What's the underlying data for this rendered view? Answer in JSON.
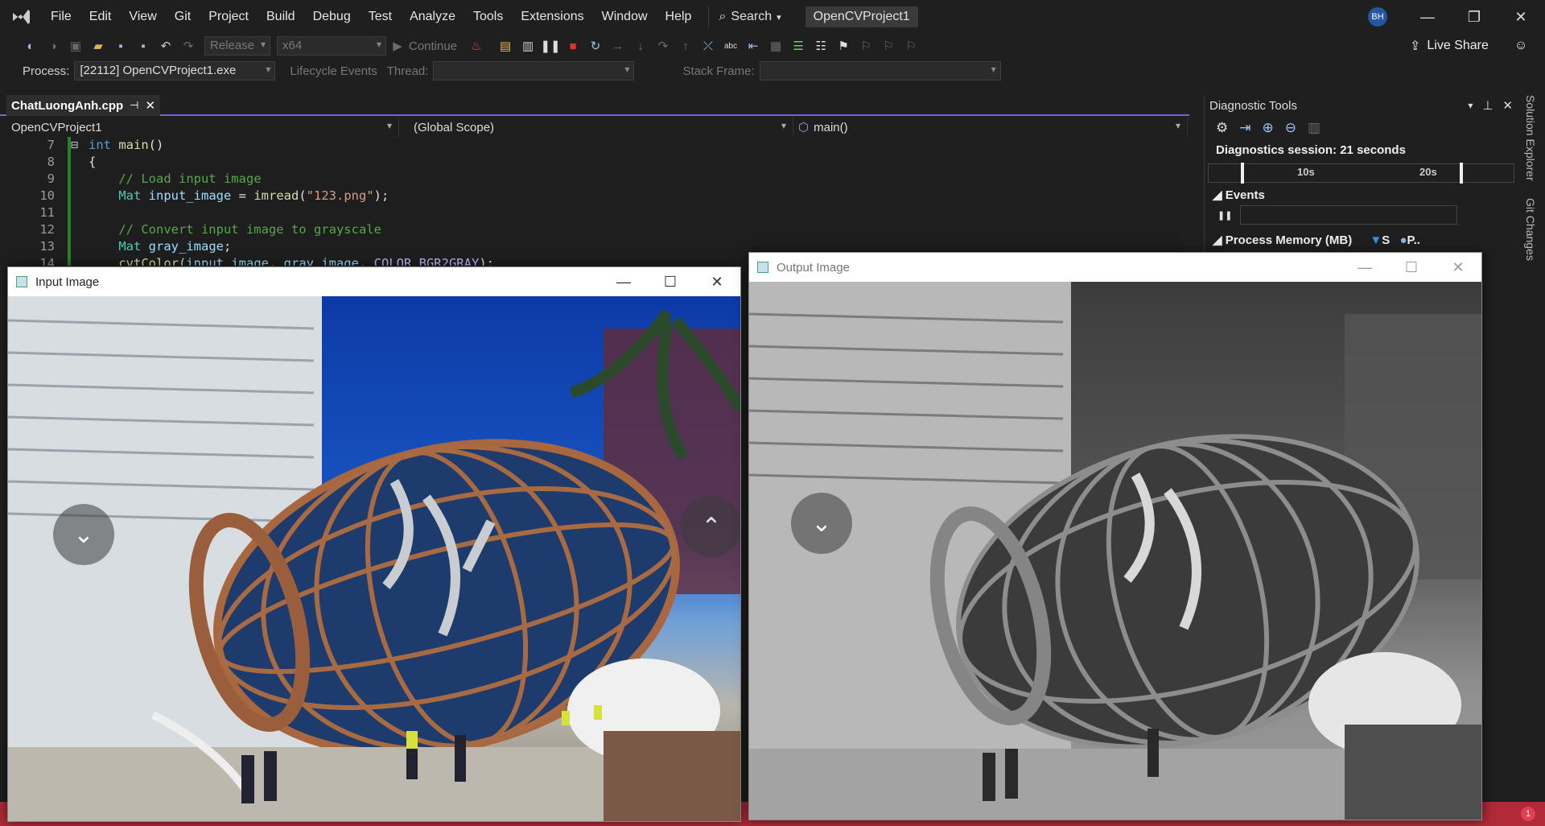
{
  "menu": [
    "File",
    "Edit",
    "View",
    "Git",
    "Project",
    "Build",
    "Debug",
    "Test",
    "Analyze",
    "Tools",
    "Extensions",
    "Window",
    "Help"
  ],
  "search_label": "Search",
  "project_name": "OpenCVProject1",
  "user_initials": "BH",
  "toolbar": {
    "config": "Release",
    "platform": "x64",
    "continue_label": "Continue",
    "live_share": "Live Share"
  },
  "process_bar": {
    "process_label": "Process:",
    "process_value": "[22112] OpenCVProject1.exe",
    "lifecycle": "Lifecycle Events",
    "thread_label": "Thread:",
    "stack_label": "Stack Frame:"
  },
  "editor": {
    "tab_name": "ChatLuongAnh.cpp",
    "nav_project": "OpenCVProject1",
    "nav_scope": "(Global Scope)",
    "nav_member": "main()",
    "lines": [
      {
        "n": "7",
        "html": "<span class='kw'>int</span> <span class='fn'>main</span>()"
      },
      {
        "n": "8",
        "html": "{"
      },
      {
        "n": "9",
        "html": "    <span class='cm'>// Load input image</span>"
      },
      {
        "n": "10",
        "html": "    <span class='ty'>Mat</span> <span class='vr'>input_image</span> = <span class='fn'>imread</span>(<span class='st'>\"123.png\"</span>);"
      },
      {
        "n": "11",
        "html": ""
      },
      {
        "n": "12",
        "html": "    <span class='cm'>// Convert input image to grayscale</span>"
      },
      {
        "n": "13",
        "html": "    <span class='ty'>Mat</span> <span class='vr'>gray_image</span>;"
      },
      {
        "n": "14",
        "html": "    <span class='fn'>cvtColor</span>(<span class='vr'>input_image</span>, <span class='vr'>gray_image</span>, <span class='mc'>COLOR_BGR2GRAY</span>);"
      }
    ]
  },
  "diagnostics": {
    "title": "Diagnostic Tools",
    "session": "Diagnostics session: 21 seconds",
    "tick_10": "10s",
    "tick_20": "20s",
    "events": "Events",
    "process_memory": "Process Memory (MB)",
    "legend_s": "S",
    "legend_p": "P..",
    "side_tab_1": "Solution Explorer",
    "side_tab_2": "Git Changes"
  },
  "input_window": {
    "title": "Input Image"
  },
  "output_window": {
    "title": "Output Image"
  },
  "status_badge": "1"
}
